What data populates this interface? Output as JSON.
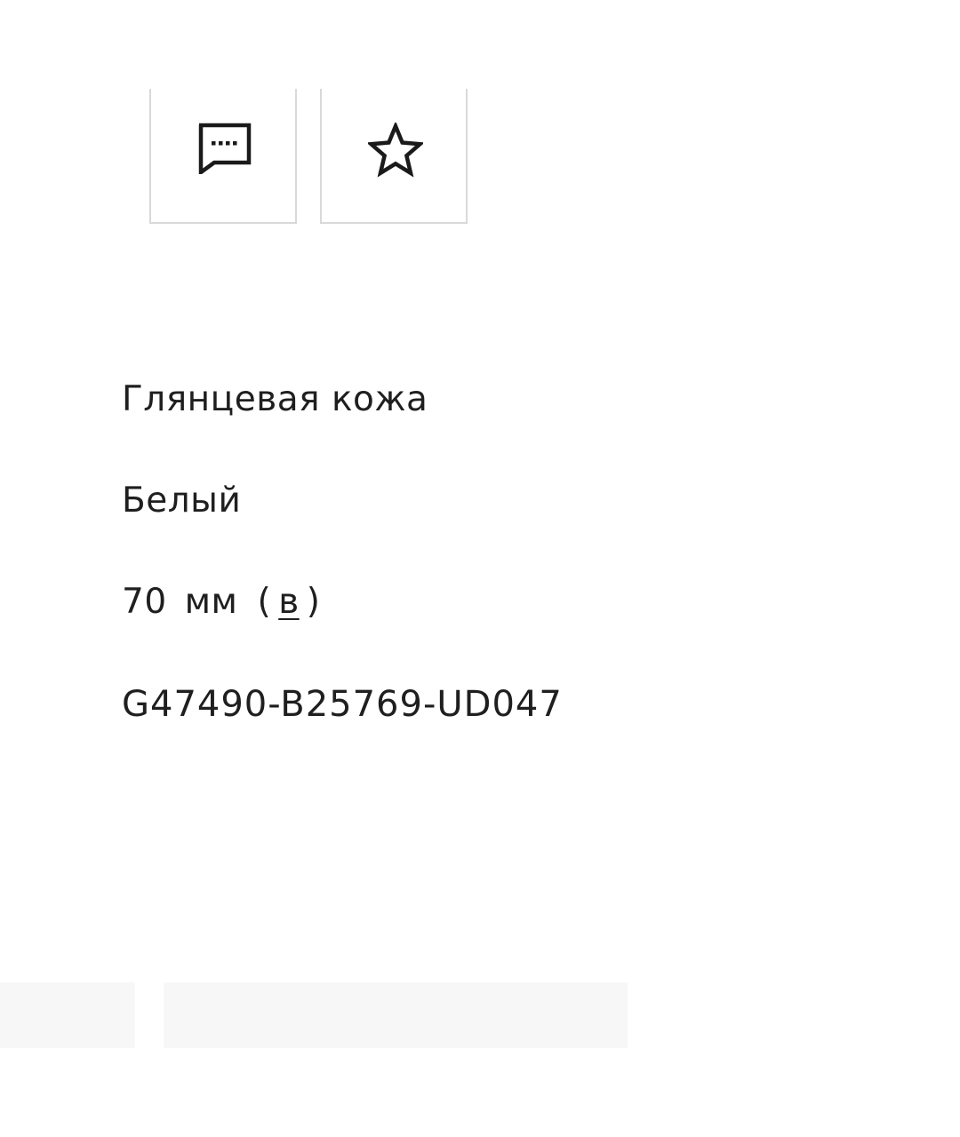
{
  "actions": {
    "comment_icon": "comment-dots-icon",
    "favorite_icon": "star-outline-icon"
  },
  "product": {
    "material": "Глянцевая кожа",
    "color": "Белый",
    "size": {
      "value": "70",
      "unit": "мм",
      "open_paren": "(",
      "link_label": "в",
      "close_paren": ")"
    },
    "sku": "G47490-B25769-UD047"
  },
  "colors": {
    "text": "#1f1f1f",
    "border": "#d9d9d9",
    "placeholder": "#f7f7f7"
  }
}
